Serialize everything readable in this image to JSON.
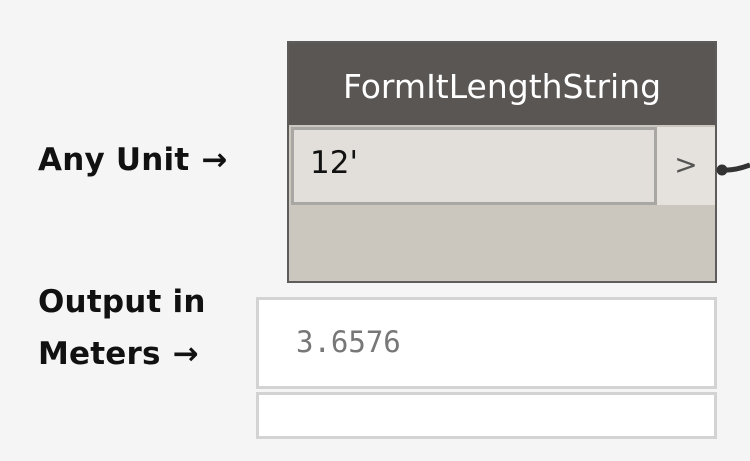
{
  "annotations": {
    "input_label": "Any Unit",
    "output_label_line1": "Output in",
    "output_label_line2": "Meters",
    "arrow": "→"
  },
  "node": {
    "title": "FormItLengthString",
    "input_value": "12'",
    "output_port_label": ">"
  },
  "preview": {
    "value": "3.6576"
  },
  "colors": {
    "header_bg": "#595654",
    "node_body": "#cbc6be",
    "input_bg": "#e2dfda",
    "wire": "#333333"
  }
}
